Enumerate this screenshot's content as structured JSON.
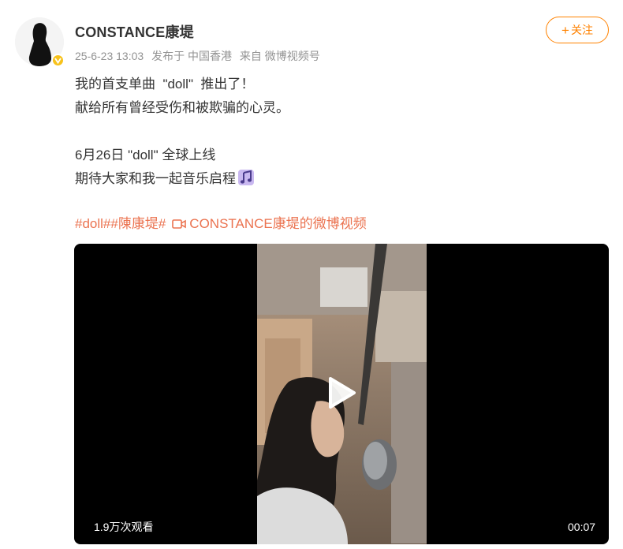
{
  "post": {
    "username": "CONSTANCE康堤",
    "date": "25-6-23 13:03",
    "location": "发布于 中国香港",
    "source": "来自 微博视频号",
    "follow_label": "关注",
    "text_lines": [
      "我的首支单曲  \"doll\"  推出了！",
      "献给所有曾经受伤和被欺骗的心灵。",
      "6月26日 \"doll\" 全球上线",
      "期待大家和我一起音乐启程"
    ],
    "tags": [
      "#doll#",
      "#陳康堤#"
    ],
    "video_link_label": "CONSTANCE康堤的微博视频",
    "video": {
      "views": "1.9万次观看",
      "duration": "00:07"
    }
  },
  "colors": {
    "accent": "#ff8200",
    "link": "#eb7350",
    "verified": "#f7c21b"
  },
  "icons": {
    "verified": "verified-badge-icon",
    "music": "music-note-icon",
    "video": "video-camera-icon",
    "play": "play-icon"
  }
}
